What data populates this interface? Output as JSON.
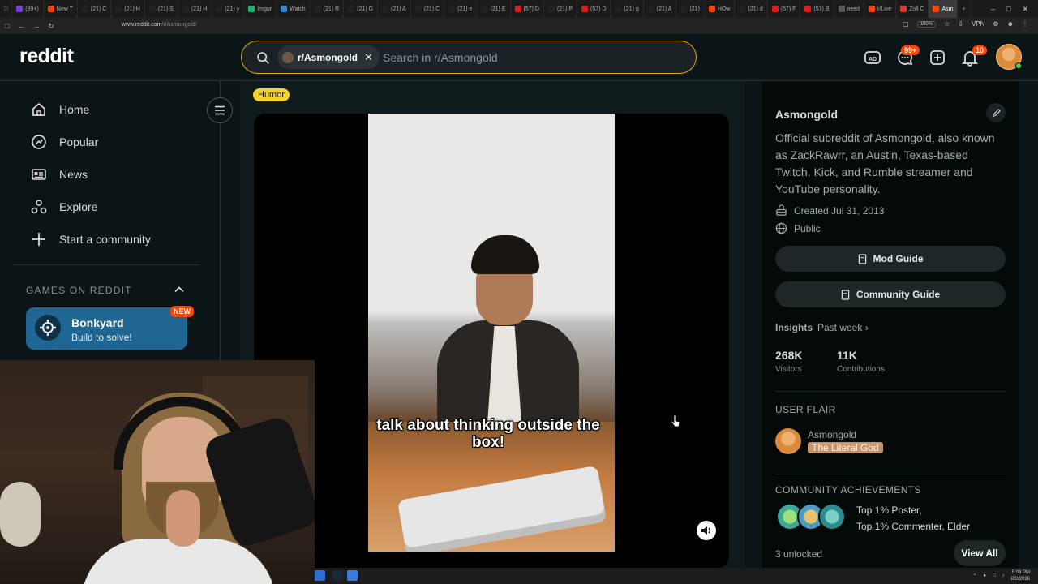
{
  "browser": {
    "tabs": [
      "(99+)",
      "New T",
      "(21) C",
      "(21) H",
      "(21) S",
      "(21) H",
      "(21) y",
      "Imgur",
      "Watch",
      "(21) R",
      "(21) G",
      "(21) A",
      "(21) C",
      "(21) e",
      "(21) E",
      "(57) D",
      "(21) P",
      "(57) D",
      "(21) g",
      "(21) A",
      "(21)",
      "HOw",
      "(21) d",
      "(57) F",
      "(57) B",
      "need",
      "r/Live",
      "Zoll C",
      "Asm"
    ],
    "tab_colors": [
      "#7a3fe0",
      "#ff4500",
      "#222222",
      "#222222",
      "#222222",
      "#222222",
      "#222222",
      "#1bb76e",
      "#2b8ae0",
      "#222222",
      "#222222",
      "#222222",
      "#222222",
      "#222222",
      "#222222",
      "#e01b1b",
      "#222222",
      "#e01b1b",
      "#222222",
      "#222222",
      "#222222",
      "#ff4500",
      "#222222",
      "#e01b1b",
      "#e01b1b",
      "#5a5a5a",
      "#ff4500",
      "#e03a2a",
      "#ff4500"
    ],
    "url_host": "www.reddit.com",
    "url_path": "/r/Asmongold/",
    "zoom": "100%",
    "vpn_label": "VPN"
  },
  "header": {
    "logo": "reddit",
    "search_chip": "r/Asmongold",
    "search_placeholder": "Search in r/Asmongold",
    "chat_badge": "99+",
    "notif_badge": "10"
  },
  "leftnav": {
    "items": [
      {
        "label": "Home",
        "icon": "home-icon"
      },
      {
        "label": "Popular",
        "icon": "popular-icon"
      },
      {
        "label": "News",
        "icon": "news-icon"
      },
      {
        "label": "Explore",
        "icon": "explore-icon"
      },
      {
        "label": "Start a community",
        "icon": "plus-icon"
      }
    ],
    "games_heading": "GAMES ON REDDIT",
    "game": {
      "name": "Bonkyard",
      "subtitle": "Build to solve!",
      "badge": "NEW"
    }
  },
  "post": {
    "flair": "Humor",
    "caption": "talk about thinking outside the box!"
  },
  "sidebar": {
    "name": "Asmongold",
    "description": "Official subreddit of Asmongold, also known as ZackRawrr, an Austin, Texas-based Twitch, Kick, and Rumble streamer and YouTube personality.",
    "created": "Created Jul 31, 2013",
    "visibility": "Public",
    "mod_guide": "Mod Guide",
    "community_guide": "Community Guide",
    "insights_label": "Insights",
    "insights_range": "Past week",
    "stats": [
      {
        "value": "268K",
        "label": "Visitors"
      },
      {
        "value": "11K",
        "label": "Contributions"
      }
    ],
    "user_flair_heading": "USER FLAIR",
    "flair_user": "Asmongold",
    "flair_tag": "The Literal God",
    "achievements_heading": "COMMUNITY ACHIEVEMENTS",
    "achievement_lines": [
      "Top 1% Poster,",
      "Top 1% Commenter, Elder"
    ],
    "unlocked": "3 unlocked",
    "view_all": "View All"
  },
  "taskbar": {
    "time": "5:08 PM",
    "date": "8/2/2026"
  }
}
